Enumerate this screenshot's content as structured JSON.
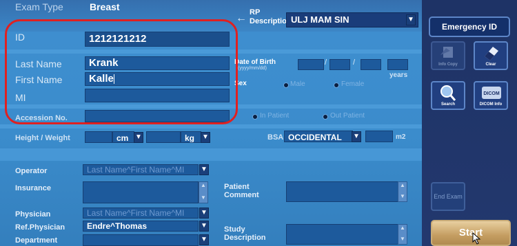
{
  "header": {
    "exam_type_label": "Exam Type",
    "exam_type_value": "Breast",
    "rp_description_label_line1": "RP",
    "rp_description_label_line2": "Description",
    "rp_description_value": "ULJ MAM SIN",
    "back_arrow": "←"
  },
  "patient": {
    "id_label": "ID",
    "id_value": "1212121212",
    "last_name_label": "Last Name",
    "last_name_value": "Krank",
    "first_name_label": "First Name",
    "first_name_value": "Kalle",
    "mi_label": "MI",
    "mi_value": "",
    "dob_label": "Date of Birth",
    "dob_format": "(yyyy/mm/dd)",
    "dob_sep": "/",
    "years_label": "years",
    "sex_label": "Sex",
    "sex_male": "Male",
    "sex_female": "Female",
    "accession_label": "Accession No.",
    "in_patient": "In Patient",
    "out_patient": "Out Patient",
    "height_weight_label": "Height / Weight",
    "cm_unit": "cm",
    "kg_unit": "kg",
    "bsa_label": "BSA",
    "bsa_value": "OCCIDENTAL",
    "m2_unit": "m2"
  },
  "staff": {
    "operator_label": "Operator",
    "operator_placeholder": "Last Name^First Name^MI",
    "insurance_label": "Insurance",
    "patient_comment_label_line1": "Patient",
    "patient_comment_label_line2": "Comment",
    "physician_label": "Physician",
    "physician_placeholder": "Last Name^First Name^MI",
    "ref_physician_label": "Ref.Physician",
    "ref_physician_value": "Endre^Thomas",
    "study_desc_label_line1": "Study",
    "study_desc_label_line2": "Description",
    "department_label": "Department"
  },
  "side_panel": {
    "emergency_id": "Emergency ID",
    "info_copy": "Info Copy",
    "clear": "Clear",
    "search": "Search",
    "dicom_info": "DICOM Info",
    "dicom_badge": "DICOM",
    "end_exam": "End Exam",
    "start": "Start"
  },
  "colors": {
    "accent_red": "#e02020",
    "panel_blue": "#3b8ccc",
    "side_navy": "#1e3366",
    "start_gold": "#c59e62"
  }
}
